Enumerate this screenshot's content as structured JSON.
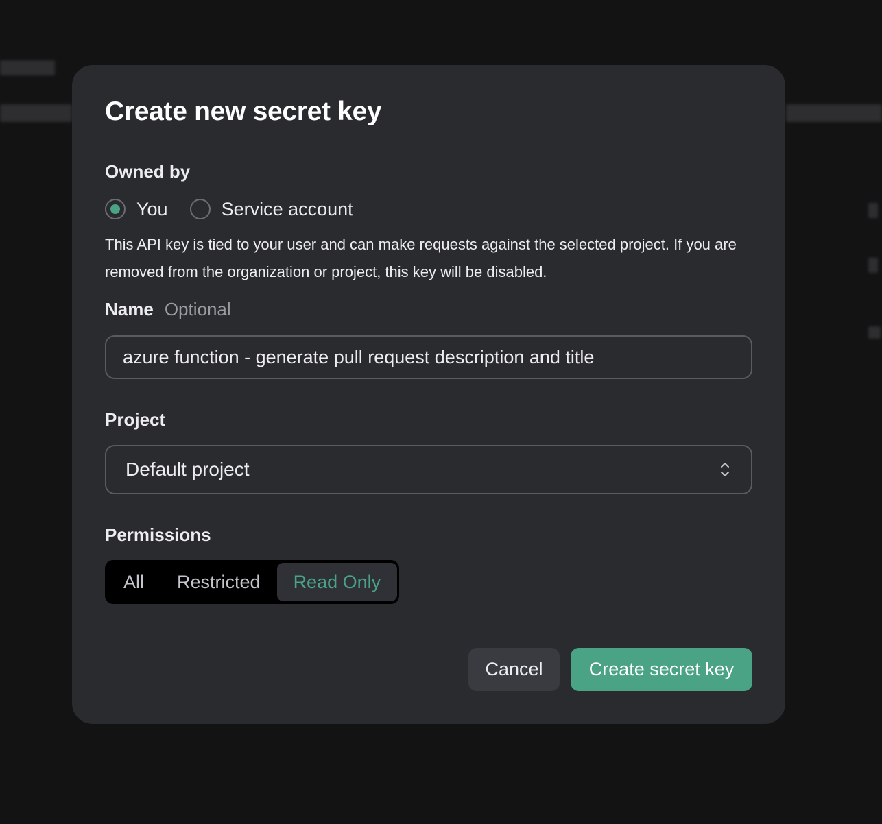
{
  "modal": {
    "title": "Create new secret key"
  },
  "owned_by": {
    "label": "Owned by",
    "options": [
      {
        "label": "You",
        "selected": true
      },
      {
        "label": "Service account",
        "selected": false
      }
    ],
    "description": "This API key is tied to your user and can make requests against the selected project. If you are removed from the organization or project, this key will be disabled."
  },
  "name_field": {
    "label": "Name",
    "hint": "Optional",
    "value": "azure function - generate pull request description and title"
  },
  "project": {
    "label": "Project",
    "selected": "Default project"
  },
  "permissions": {
    "label": "Permissions",
    "options": [
      "All",
      "Restricted",
      "Read Only"
    ],
    "selected": "Read Only"
  },
  "actions": {
    "cancel_label": "Cancel",
    "create_label": "Create secret key"
  },
  "colors": {
    "accent": "#4aa384",
    "modal_bg": "#2a2b2f",
    "backdrop": "#131314"
  }
}
